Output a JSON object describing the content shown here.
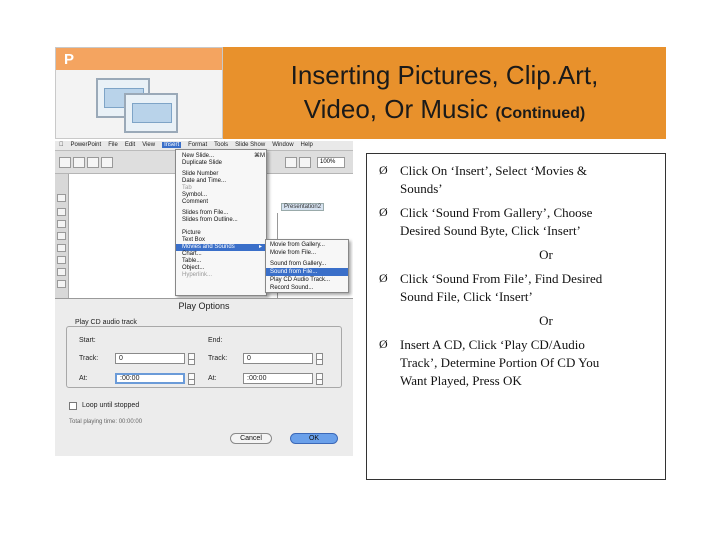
{
  "header": {
    "title_line1": "Inserting Pictures, Clip.Art,",
    "title_line2": "Video, Or Music",
    "title_suffix": "(Continued)",
    "logo_letter": "P"
  },
  "colors": {
    "banner": "#e8912c",
    "logo_strip": "#f4a460",
    "menu_highlight": "#3a6fc9",
    "ok_button": "#6aa0ea"
  },
  "menubar": {
    "items": [
      "PowerPoint",
      "File",
      "Edit",
      "View",
      "Insert",
      "Format",
      "Tools",
      "Slide Show",
      "Window",
      "Help"
    ]
  },
  "insert_menu": {
    "items": [
      "New Slide...",
      "Duplicate Slide",
      "Slide Number",
      "Date and Time...",
      "Tab",
      "Symbol...",
      "Comment",
      "Slides from File...",
      "Slides from Outline...",
      "Picture",
      "Text Box",
      "Movies and Sounds",
      "Chart...",
      "Table...",
      "Object...",
      "Hyperlink..."
    ],
    "selected": "Movies and Sounds",
    "shortcut": "⌘M"
  },
  "submenu": {
    "items": [
      "Movie from Gallery...",
      "Movie from File...",
      "Sound from Gallery...",
      "Sound from File...",
      "Play CD Audio Track...",
      "Record Sound..."
    ],
    "selected": "Sound from File..."
  },
  "document": {
    "window_label": "Presentation2",
    "zoom": "100%"
  },
  "play_dialog": {
    "title": "Play Options",
    "group_label": "Play CD audio track",
    "start_label": "Start:",
    "end_label": "End:",
    "track_label": "Track:",
    "at_label": "At:",
    "start_track": "0",
    "end_track": "0",
    "start_at": ":00:00",
    "end_at": ":00:00",
    "loop_label": "Loop until stopped",
    "total_time_label": "Total playing time:",
    "total_time_value": "00:00:00",
    "cancel_label": "Cancel",
    "ok_label": "OK"
  },
  "bullets": {
    "symbol": "Ø",
    "item1_line1": "Click On ‘Insert’, Select ‘Movies &",
    "item1_line2": "Sounds’",
    "item2_line1": "Click ‘Sound From Gallery’, Choose",
    "item2_line2": "Desired Sound Byte, Click ‘Insert’",
    "or1": "Or",
    "item3_line1": "Click ‘Sound From File’, Find Desired",
    "item3_line2": "Sound File, Click ‘Insert’",
    "or2": "Or",
    "item4_line1": "Insert A CD, Click ‘Play CD/Audio",
    "item4_line2": "Track’, Determine Portion Of CD You",
    "item4_line3": "Want Played, Press OK"
  }
}
